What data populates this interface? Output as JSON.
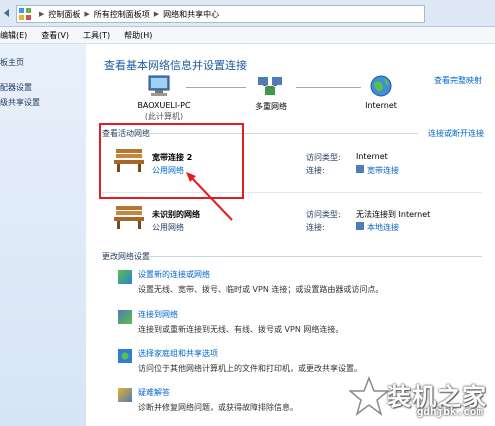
{
  "address_bar": {
    "crumbs": [
      "控制面板",
      "所有控制面板项",
      "网络和共享中心"
    ]
  },
  "menu": [
    "编辑(E)",
    "查看(V)",
    "工具(T)",
    "帮助(H)"
  ],
  "left_pane": {
    "items": [
      "板主页",
      "配器设置",
      "级共享设置"
    ]
  },
  "main": {
    "title": "查看基本网络信息并设置连接",
    "view_full_map": "查看完整映射",
    "nodes": {
      "pc_name": "BAOXUELI-PC",
      "pc_sub": "(此计算机)",
      "multi_network": "多重网络",
      "internet": "Internet"
    },
    "active_networks_label": "查看活动网络",
    "connect_or_disconnect": "连接或断开连接",
    "networks": [
      {
        "name": "宽带连接  2",
        "type": "公用网络",
        "access_type_label": "访问类型:",
        "access_type": "Internet",
        "connection_label": "连接:",
        "connection": "宽带连接"
      },
      {
        "name": "未识别的网络",
        "type": "公用网络",
        "access_type_label": "访问类型:",
        "access_type": "无法连接到 Internet",
        "connection_label": "连接:",
        "connection": "本地连接"
      }
    ],
    "change_settings_label": "更改网络设置",
    "tasks": [
      {
        "title": "设置新的连接或网络",
        "desc": "设置无线、宽带、拨号、临时或 VPN 连接；或设置路由器或访问点。"
      },
      {
        "title": "连接到网络",
        "desc": "连接到或重新连接到无线、有线、拨号或 VPN 网络连接。"
      },
      {
        "title": "选择家庭组和共享选项",
        "desc": "访问位于其他网络计算机上的文件和打印机，或更改共享设置。"
      },
      {
        "title": "疑难解答",
        "desc": "诊断并修复网络问题，或获得故障排除信息。"
      }
    ]
  },
  "watermark": {
    "title": "装机之家",
    "url": "gdhjbk.com"
  }
}
